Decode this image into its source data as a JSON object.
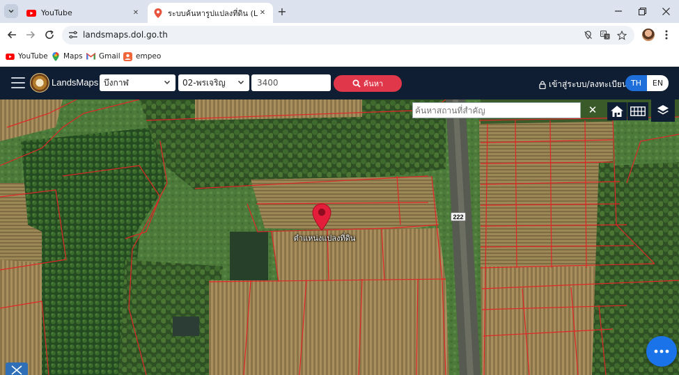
{
  "browser": {
    "tabs": [
      {
        "title": "YouTube",
        "icon": "youtube-icon",
        "active": false
      },
      {
        "title": "ระบบค้นหารูปแปลงที่ดิน (LandsMaps)",
        "icon": "map-pin-icon",
        "active": true
      }
    ],
    "url": "landsmaps.dol.go.th",
    "bookmarks": [
      {
        "label": "YouTube",
        "icon": "youtube-icon"
      },
      {
        "label": "Maps",
        "icon": "google-maps-icon"
      },
      {
        "label": "Gmail",
        "icon": "gmail-icon"
      },
      {
        "label": "empeo",
        "icon": "empeo-icon"
      }
    ]
  },
  "app": {
    "brand": "LandsMaps",
    "province_select": "บึงกาฬ",
    "district_select": "02-พรเจริญ",
    "parcel_number": "3400",
    "search_label": "ค้นหา",
    "login_label": "เข้าสู่ระบบ/ลงทะเบียน",
    "lang_th": "TH",
    "lang_en": "EN",
    "accent_color": "#e0384a",
    "header_color": "#0f1e32"
  },
  "map": {
    "place_search_placeholder": "ค้นหาสถานที่สำคัญ",
    "road_number": "222",
    "parcel_label": "ตำแหน่งแปลงที่ดิน",
    "tools": [
      "home-icon",
      "grid-icon",
      "layers-icon"
    ]
  }
}
